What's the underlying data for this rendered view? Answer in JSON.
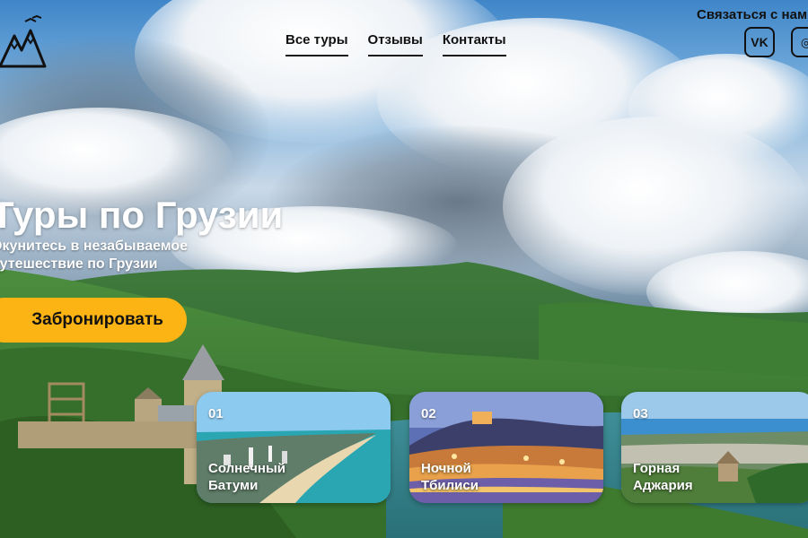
{
  "nav": {
    "items": [
      {
        "label": "Все туры"
      },
      {
        "label": "Отзывы"
      },
      {
        "label": "Контакты"
      }
    ]
  },
  "contact": {
    "label": "Связаться с нами",
    "social": [
      {
        "label": "VK",
        "icon": "vk-icon"
      },
      {
        "label": "◎",
        "icon": "instagram-icon"
      }
    ]
  },
  "hero": {
    "title": "Туры по Грузии",
    "subtitle": "Окунитесь в незабываемое путешествие по Грузии",
    "cta": "Забронировать"
  },
  "tours": [
    {
      "num": "01",
      "label": "Солнечный Батуми"
    },
    {
      "num": "02",
      "label": "Ночной Тбилиси"
    },
    {
      "num": "03",
      "label": "Горная Аджария"
    }
  ],
  "colors": {
    "accent": "#fcb415",
    "text_dark": "#111111",
    "text_light": "#ffffff"
  }
}
